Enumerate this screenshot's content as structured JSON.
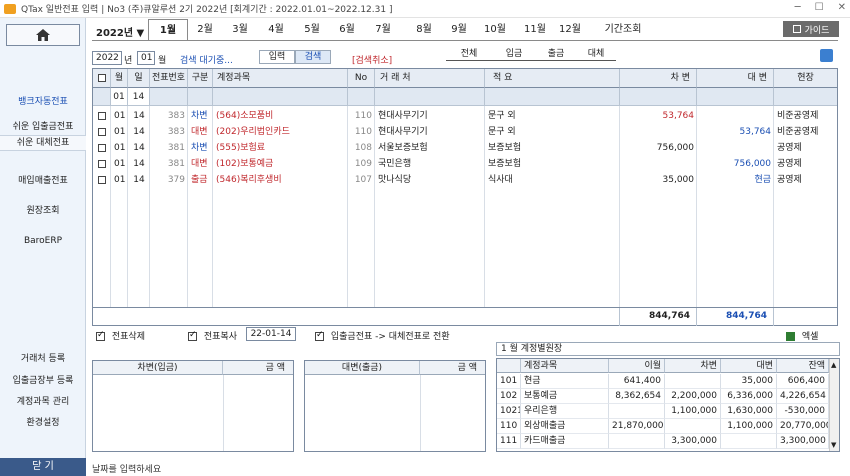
{
  "window": {
    "title": "QTax 일반전표 입력 | No3 (주)큐알루션 2기 2022년 [회계기간 : 2022.01.01~2022.12.31 ]",
    "min": "─",
    "max": "☐",
    "close": "✕"
  },
  "sidebar": {
    "items": [
      "뱅크자동전표",
      "쉬운 입출금전표",
      "쉬운 대체전표",
      "매입매출전표",
      "원장조회",
      "BaroERP",
      "거래처 등록",
      "입출금장부 등록",
      "계정과목 관리",
      "환경설정"
    ],
    "close_label": "닫 기"
  },
  "year_label": "2022년 ▼",
  "months": [
    "1월",
    "2월",
    "3월",
    "4월",
    "5월",
    "6월",
    "7월",
    "8월",
    "9월",
    "10월",
    "11월",
    "12월",
    "기간조회"
  ],
  "guide_label": "가이드",
  "search": {
    "year": "2022",
    "year_suffix": "년",
    "month": "01",
    "month_suffix": "월",
    "status": "검색 대기중...",
    "input_label": "입력",
    "search_label": "검색",
    "cancel_label": "[검색취소]"
  },
  "filters": [
    "전체",
    "입금",
    "출금",
    "대체"
  ],
  "table": {
    "headers": [
      "☐",
      "월",
      "일",
      "전표번호",
      "구분",
      "계정과목",
      "No",
      "거 래 처",
      "적    요",
      "차 변",
      "대 변",
      "현장"
    ],
    "input_month": "01",
    "input_day": "14",
    "rows": [
      {
        "m": "01",
        "d": "14",
        "no": "383",
        "type": "차변",
        "acct": "(564)소모품비",
        "cno": "110",
        "client": "현대사무기기",
        "memo": "문구 외",
        "debit": "53,764",
        "credit": "",
        "site": "비준공영제"
      },
      {
        "m": "01",
        "d": "14",
        "no": "383",
        "type": "대변",
        "acct": "(202)우리법인카드",
        "cno": "110",
        "client": "현대사무기기",
        "memo": "문구 외",
        "debit": "",
        "credit": "53,764",
        "site": "비준공영제"
      },
      {
        "m": "01",
        "d": "14",
        "no": "381",
        "type": "차변",
        "acct": "(555)보험료",
        "cno": "108",
        "client": "서울보증보험",
        "memo": "보증보험",
        "debit": "756,000",
        "credit": "",
        "site": "공영제"
      },
      {
        "m": "01",
        "d": "14",
        "no": "381",
        "type": "대변",
        "acct": "(102)보통예금",
        "cno": "109",
        "client": "국민은행",
        "memo": "보증보험",
        "debit": "",
        "credit": "756,000",
        "site": "공영제"
      },
      {
        "m": "01",
        "d": "14",
        "no": "379",
        "type": "출금",
        "acct": "(546)복리후생비",
        "cno": "107",
        "client": "맛나식당",
        "memo": "식사대",
        "debit": "35,000",
        "credit": "현금",
        "site": "공영제"
      }
    ],
    "total_debit": "844,764",
    "total_credit": "844,764"
  },
  "options": {
    "delete_label": "전표삭제",
    "copy_label": "전표복사",
    "copy_date": "22-01-14",
    "convert_label": "입출금전표 -> 대체전표로 전환",
    "excel_label": "엑셀"
  },
  "debit_grid": {
    "col1": "차변(입금)",
    "col2": "금  액"
  },
  "credit_grid": {
    "col1": "대변(출금)",
    "col2": "금  액"
  },
  "ledger": {
    "title": "1 월  계정별원장",
    "headers": [
      "계정과목",
      "이월",
      "차변",
      "대변",
      "잔액"
    ],
    "rows": [
      {
        "code": "101",
        "name": "현금",
        "carry": "641,400",
        "debit": "",
        "credit": "35,000",
        "balance": "606,400"
      },
      {
        "code": "102",
        "name": "보통예금",
        "carry": "8,362,654",
        "debit": "2,200,000",
        "credit": "6,336,000",
        "balance": "4,226,654"
      },
      {
        "code": "1021",
        "name": "우리은행",
        "carry": "",
        "debit": "1,100,000",
        "credit": "1,630,000",
        "balance": "-530,000"
      },
      {
        "code": "110",
        "name": "외상매출금",
        "carry": "21,870,000",
        "debit": "",
        "credit": "1,100,000",
        "balance": "20,770,000"
      },
      {
        "code": "111",
        "name": "카드매출금",
        "carry": "",
        "debit": "3,300,000",
        "credit": "",
        "balance": "3,300,000"
      }
    ]
  },
  "status_text": "날짜를 입력하세요",
  "colors": {
    "accent": "#1b4fb3",
    "red": "#c0282d",
    "sidebar": "#eef4fb"
  }
}
